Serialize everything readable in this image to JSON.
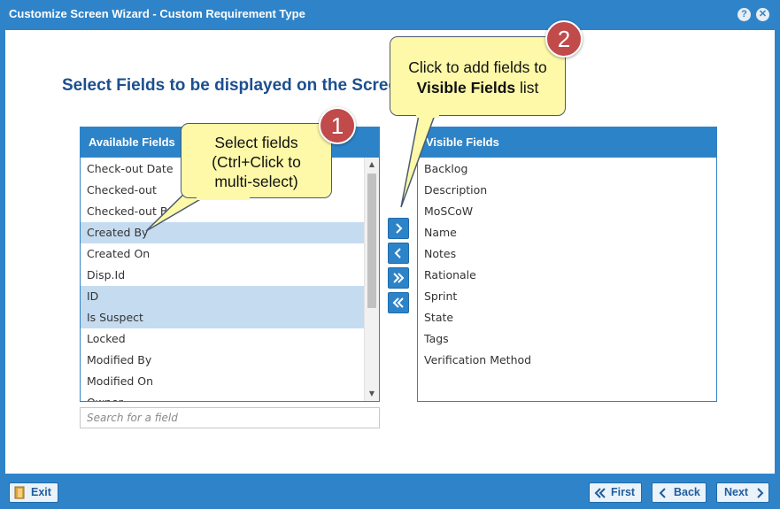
{
  "window": {
    "title": "Customize Screen Wizard - Custom Requirement Type",
    "help_icon": "?",
    "close_icon": "✕"
  },
  "page_title": "Select Fields to be displayed on the Scree",
  "available": {
    "header": "Available Fields",
    "items": [
      {
        "label": "Check-out Date",
        "selected": false
      },
      {
        "label": "Checked-out",
        "selected": false
      },
      {
        "label": "Checked-out By",
        "selected": false
      },
      {
        "label": "Created By",
        "selected": true
      },
      {
        "label": "Created On",
        "selected": false
      },
      {
        "label": "Disp.Id",
        "selected": false
      },
      {
        "label": "ID",
        "selected": true
      },
      {
        "label": "Is Suspect",
        "selected": true
      },
      {
        "label": "Locked",
        "selected": false
      },
      {
        "label": "Modified By",
        "selected": false
      },
      {
        "label": "Modified On",
        "selected": false
      },
      {
        "label": "Owner",
        "selected": false
      }
    ]
  },
  "visible": {
    "header": "Visible Fields",
    "items": [
      "Backlog",
      "Description",
      "MoSCoW",
      "Name",
      "Notes",
      "Rationale",
      "Sprint",
      "State",
      "Tags",
      "Verification Method"
    ]
  },
  "search": {
    "placeholder": "Search for a field",
    "value": ""
  },
  "move_buttons": [
    "add-selected",
    "remove-selected",
    "add-all",
    "remove-all"
  ],
  "callouts": {
    "one": {
      "number": "1",
      "line1": "Select fields",
      "line2": "(Ctrl+Click to",
      "line3": "multi-select)"
    },
    "two": {
      "number": "2",
      "line1": "Click to add fields to",
      "line2_bold": "Visible Fields",
      "line2_rest": " list"
    }
  },
  "footer": {
    "exit": "Exit",
    "first": "First",
    "back": "Back",
    "next": "Next"
  },
  "colors": {
    "accent": "#2f84c9",
    "selection": "#c5dcf0",
    "callout": "#fdf9a8",
    "badge": "#c14a4a",
    "title_text": "#1c4f8f"
  }
}
